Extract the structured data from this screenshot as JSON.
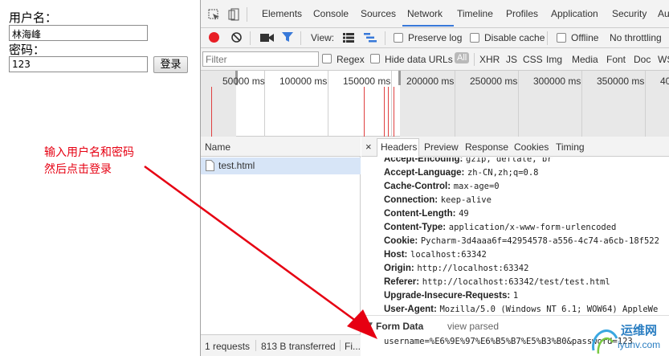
{
  "page": {
    "username_label": "用户名：",
    "username_value": "林海峰",
    "password_label": "密码：",
    "password_value": "123",
    "login_button": "登录",
    "annotation_line1": "输入用户名和密码",
    "annotation_line2": "然后点击登录"
  },
  "devtools": {
    "tabs": [
      "Elements",
      "Console",
      "Sources",
      "Network",
      "Timeline",
      "Profiles",
      "Application",
      "Security",
      "Au"
    ],
    "active_tab": "Network",
    "toolbar": {
      "view_label": "View:",
      "preserve_log": "Preserve log",
      "disable_cache": "Disable cache",
      "offline": "Offline",
      "throttling": "No throttling"
    },
    "filter": {
      "placeholder": "Filter",
      "regex": "Regex",
      "hide_data_urls": "Hide data URLs",
      "types": [
        "All",
        "XHR",
        "JS",
        "CSS",
        "Img",
        "Media",
        "Font",
        "Doc",
        "WS"
      ]
    },
    "timeline_labels": [
      "50000 ms",
      "100000 ms",
      "150000 ms",
      "200000 ms",
      "250000 ms",
      "300000 ms",
      "350000 ms",
      "40"
    ],
    "name_column": "Name",
    "requests": [
      "test.html"
    ],
    "status": {
      "requests": "1 requests",
      "transferred": "813 B transferred",
      "finish": "Fi..."
    },
    "detail_tabs": [
      "Headers",
      "Preview",
      "Response",
      "Cookies",
      "Timing"
    ],
    "active_detail_tab": "Headers",
    "headers": [
      {
        "key": "Accept-Encoding:",
        "value": "gzip, deflate, br"
      },
      {
        "key": "Accept-Language:",
        "value": "zh-CN,zh;q=0.8"
      },
      {
        "key": "Cache-Control:",
        "value": "max-age=0"
      },
      {
        "key": "Connection:",
        "value": "keep-alive"
      },
      {
        "key": "Content-Length:",
        "value": "49"
      },
      {
        "key": "Content-Type:",
        "value": "application/x-www-form-urlencoded"
      },
      {
        "key": "Cookie:",
        "value": "Pycharm-3d4aaa6f=42954578-a556-4c74-a6cb-18f522"
      },
      {
        "key": "Host:",
        "value": "localhost:63342"
      },
      {
        "key": "Origin:",
        "value": "http://localhost:63342"
      },
      {
        "key": "Referer:",
        "value": "http://localhost:63342/test/test.html"
      },
      {
        "key": "Upgrade-Insecure-Requests:",
        "value": "1"
      },
      {
        "key": "User-Agent:",
        "value": "Mozilla/5.0 (Windows NT 6.1; WOW64) AppleWe"
      }
    ],
    "form_data": {
      "title": "Form Data",
      "view_parsed": "view parsed",
      "body": "username=%E6%9E%97%E6%B5%B7%E5%B3%B0&password=123"
    }
  },
  "watermark": {
    "cn": "运维网",
    "en": "iyunv.com"
  },
  "colors": {
    "accent": "#3879d9",
    "record": "#e81e25",
    "annotation": "#e60012"
  }
}
